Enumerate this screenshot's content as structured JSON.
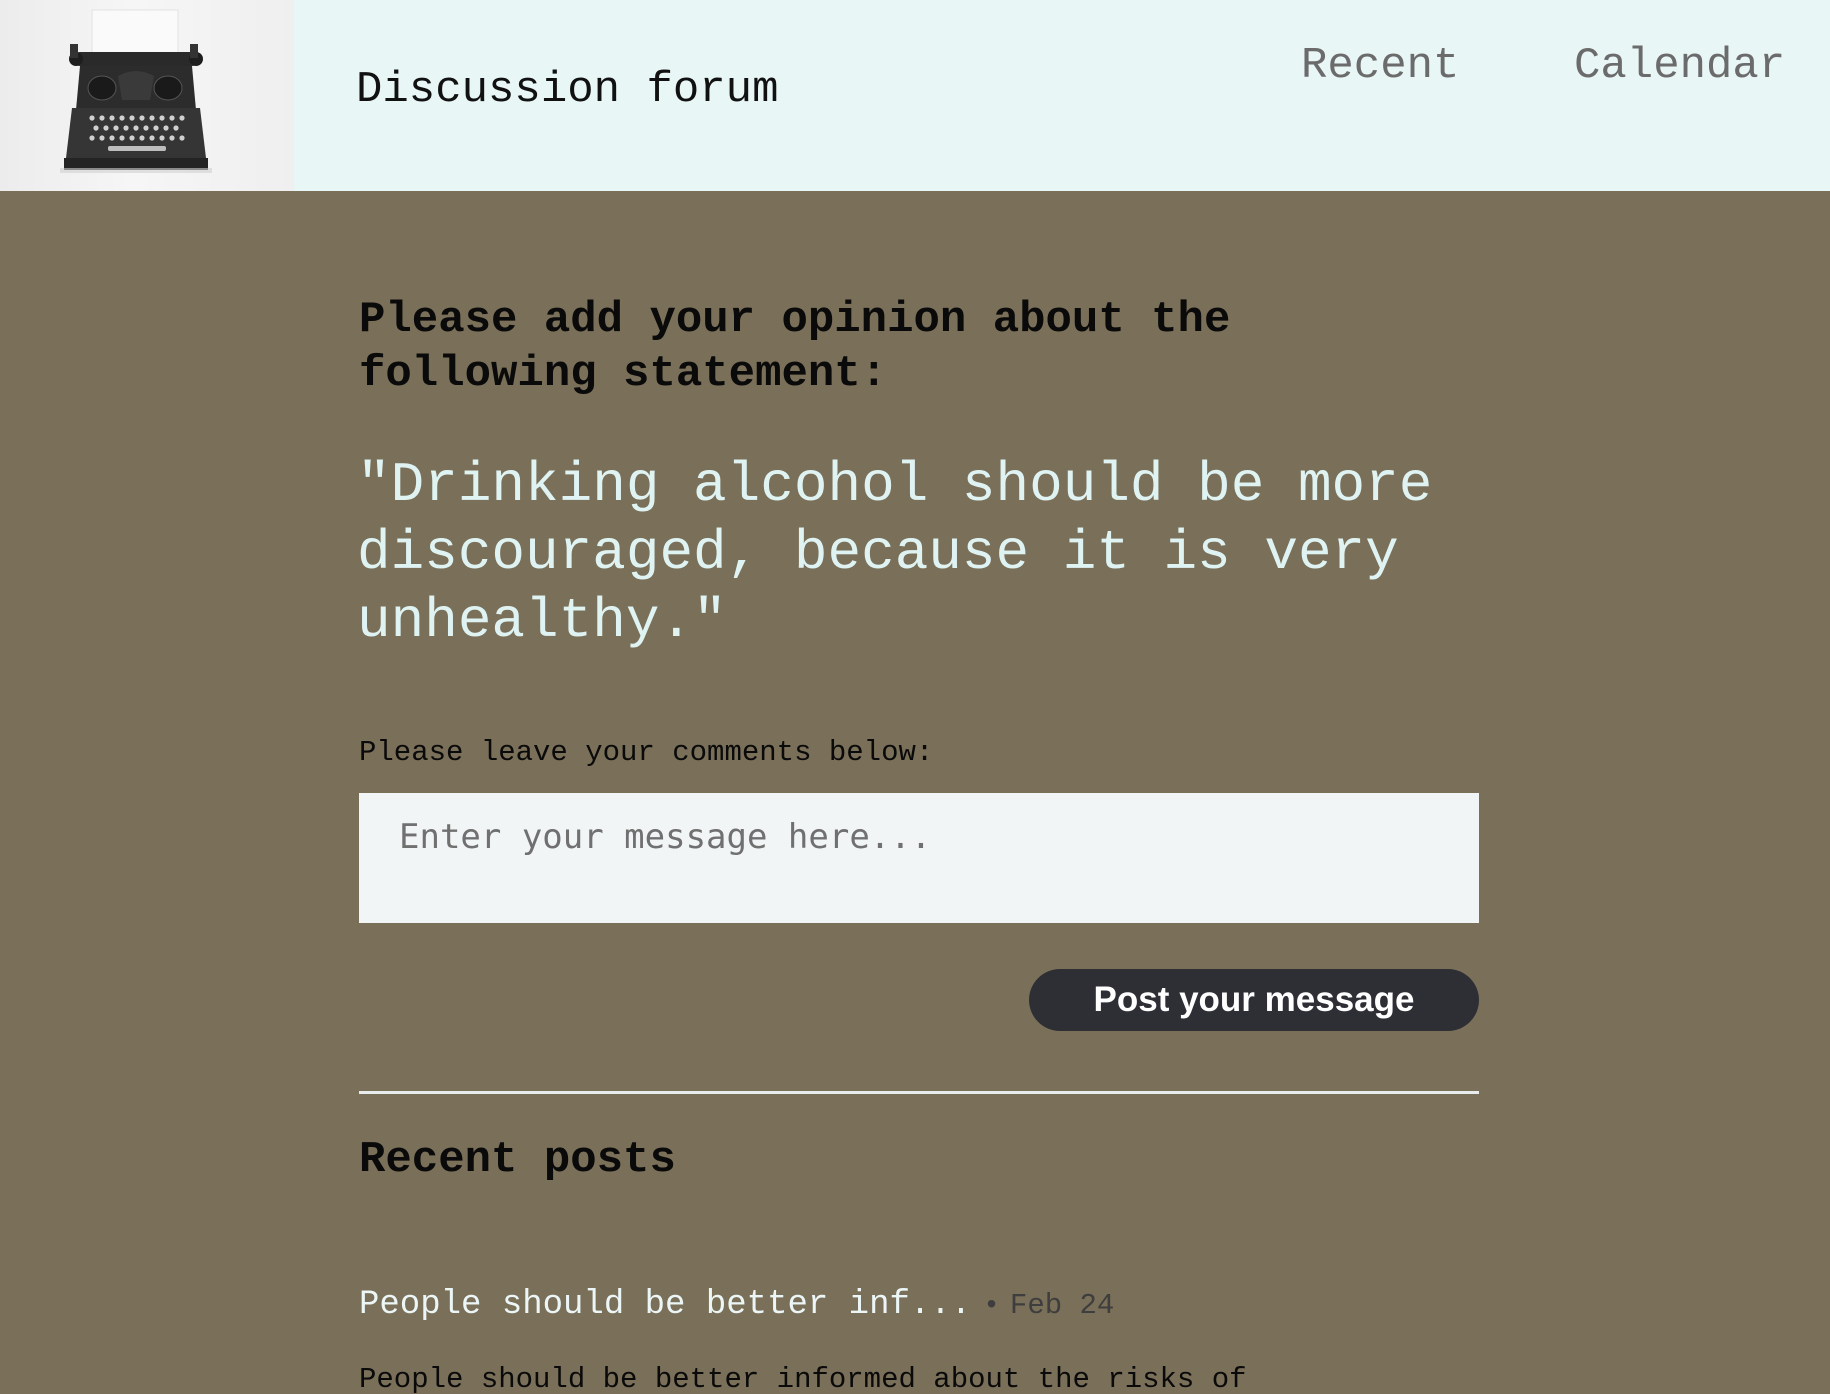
{
  "header": {
    "site_title": "Discussion forum",
    "nav": [
      {
        "label": "Recent"
      },
      {
        "label": "Calendar"
      }
    ]
  },
  "main": {
    "prompt_heading": "Please add your opinion about the following statement:",
    "statement": "\"Drinking alcohol should be more discouraged, because it is very unhealthy.\"",
    "comments_label": "Please leave your comments below:",
    "message_placeholder": "Enter your message here...",
    "post_button_label": "Post your message",
    "recent_heading": "Recent posts",
    "recent_posts": [
      {
        "title": "People should be better inf...",
        "separator": "•",
        "date": "Feb 24",
        "excerpt": "People should be better informed about the risks of"
      }
    ]
  },
  "colors": {
    "page_background": "#7a6f58",
    "header_background": "#e8f6f6",
    "statement_text": "#dff3f3",
    "button_background": "#2d2f35"
  },
  "icons": {
    "logo": "typewriter-logo-icon"
  }
}
